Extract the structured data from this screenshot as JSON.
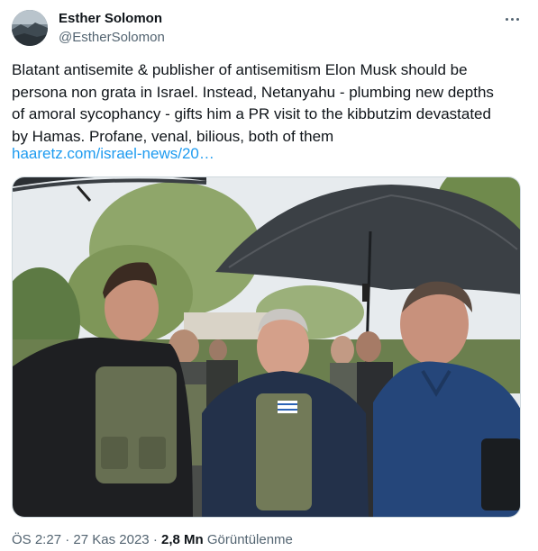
{
  "author": {
    "name": "Esther Solomon",
    "handle": "@EstherSolomon"
  },
  "tweet": {
    "text_lines": [
      "Blatant antisemite & publisher of antisemitism Elon Musk should be",
      "persona non grata in Israel. Instead, Netanyahu - plumbing new depths",
      "of amoral sycophancy - gifts him a PR visit to the kibbutzim devastated",
      "by Hamas. Profane, venal, bilious, both of them"
    ],
    "link": "haaretz.com/israel-news/20…"
  },
  "footer": {
    "time": "ÖS 2:27",
    "sep1": "·",
    "date": "27 Kas 2023",
    "sep2": "·",
    "views_count": "2,8 Mn",
    "views_label": "Görüntülenme"
  },
  "icons": {
    "more": "more-horizontal-icon"
  },
  "colors": {
    "text": "#0f1419",
    "secondary": "#536471",
    "link": "#1d9bf0"
  }
}
